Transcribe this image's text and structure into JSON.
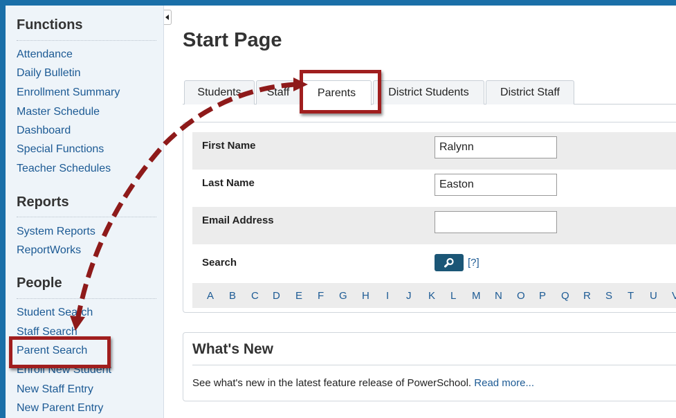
{
  "sidebar": {
    "functions_heading": "Functions",
    "functions": [
      "Attendance",
      "Daily Bulletin",
      "Enrollment Summary",
      "Master Schedule",
      "Dashboard",
      "Special Functions",
      "Teacher Schedules"
    ],
    "reports_heading": "Reports",
    "reports": [
      "System Reports",
      "ReportWorks"
    ],
    "people_heading": "People",
    "people": [
      "Student Search",
      "Staff Search",
      "Parent Search",
      "Enroll New Student",
      "New Staff Entry",
      "New Parent Entry"
    ]
  },
  "main": {
    "title": "Start Page",
    "tabs": [
      "Students",
      "Staff",
      "Parents",
      "District Students",
      "District Staff"
    ],
    "active_tab": "Parents",
    "form": {
      "first_name_label": "First Name",
      "first_name_value": "Ralynn",
      "last_name_label": "Last Name",
      "last_name_value": "Easton",
      "email_label": "Email Address",
      "email_value": "",
      "search_label": "Search",
      "help_link": "[?]"
    },
    "alphabet": [
      "A",
      "B",
      "C",
      "D",
      "E",
      "F",
      "G",
      "H",
      "I",
      "J",
      "K",
      "L",
      "M",
      "N",
      "O",
      "P",
      "Q",
      "R",
      "S",
      "T",
      "U",
      "V"
    ],
    "whats_new": {
      "title": "What's New",
      "text": "See what's new in the latest feature release of PowerSchool.",
      "link": "Read more..."
    }
  },
  "colors": {
    "frame_blue": "#1a6fa8",
    "link_blue": "#1c5a94",
    "annotation_red": "#a01e1e",
    "search_button": "#1b5676"
  }
}
